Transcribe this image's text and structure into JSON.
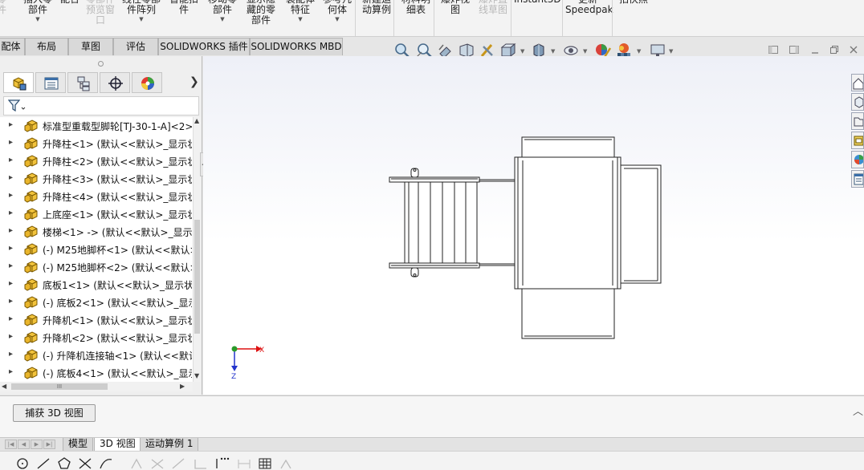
{
  "ribbon": {
    "items": [
      {
        "label": "零\n件",
        "dim": true,
        "arrow": false
      },
      {
        "label": "插入零\n部件",
        "dim": false,
        "arrow": true
      },
      {
        "label": "配合",
        "dim": false,
        "arrow": false
      },
      {
        "label": "零部件\n预览窗\n口",
        "dim": true,
        "arrow": false
      },
      {
        "label": "线性零部\n件阵列",
        "dim": false,
        "arrow": true
      },
      {
        "label": "智能扣\n件",
        "dim": false,
        "arrow": false
      },
      {
        "label": "移动零\n部件",
        "dim": false,
        "arrow": true
      },
      {
        "label": "显示隐\n藏的零\n部件",
        "dim": false,
        "arrow": false
      },
      {
        "label": "装配体\n特征",
        "dim": false,
        "arrow": true
      },
      {
        "label": "参考几\n何体",
        "dim": false,
        "arrow": true
      },
      {
        "label": "新建运\n动算例",
        "dim": false,
        "arrow": false
      },
      {
        "label": "材料明\n细表",
        "dim": false,
        "arrow": false
      },
      {
        "label": "爆炸视\n图",
        "dim": false,
        "arrow": false
      },
      {
        "label": "爆炸直\n线草图",
        "dim": true,
        "arrow": false
      },
      {
        "label": "Instant3D",
        "dim": false,
        "arrow": false
      },
      {
        "label": "更新\nSpeedpak",
        "dim": false,
        "arrow": false
      },
      {
        "label": "拍快照",
        "dim": false,
        "arrow": false
      }
    ]
  },
  "tabs": [
    "配体",
    "布局",
    "草图",
    "评估",
    "SOLIDWORKS 插件",
    "SOLIDWORKS MBD"
  ],
  "tree": {
    "items": [
      "标准型重载型脚轮[TJ-30-1-A]<2>",
      "升降柱<1> (默认<<默认>_显示状",
      "升降柱<2> (默认<<默认>_显示状",
      "升降柱<3> (默认<<默认>_显示状",
      "升降柱<4> (默认<<默认>_显示状",
      "上底座<1> (默认<<默认>_显示状",
      "楼梯<1> -> (默认<<默认>_显示状",
      "(-) M25地脚杯<1> (默认<<默认>",
      "(-) M25地脚杯<2> (默认<<默认>",
      "底板1<1> (默认<<默认>_显示状态",
      "(-) 底板2<1> (默认<<默认>_显示",
      "升降机<1> (默认<<默认>_显示状",
      "升降机<2> (默认<<默认>_显示状",
      "(-) 升降机连接轴<1> (默认<<默认",
      "(-) 底板4<1> (默认<<默认>_显示"
    ]
  },
  "hscroll_label": "III",
  "triad": {
    "x_label": "X",
    "z_label": "Z"
  },
  "bottom": {
    "capture_button": "捕获 3D 视图"
  },
  "bottom_tabs": [
    "模型",
    "3D 视图",
    "运动算例 1"
  ],
  "colors": {
    "accent": "#e8b400",
    "graphics_top": "#eef0f7"
  }
}
